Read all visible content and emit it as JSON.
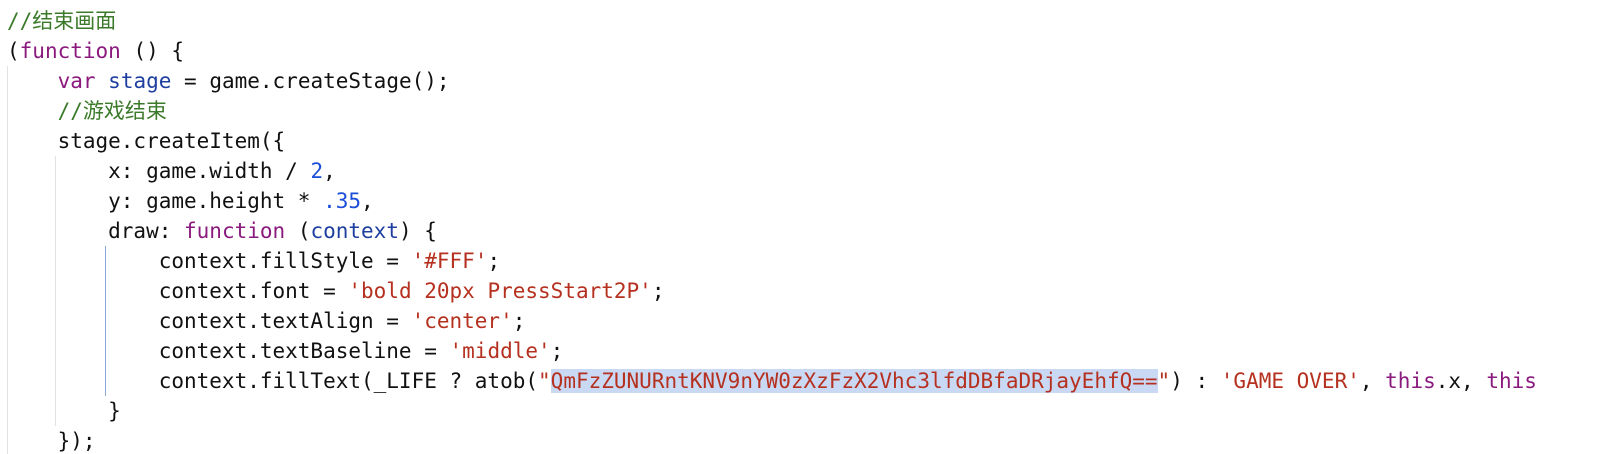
{
  "editor": {
    "language": "javascript",
    "colors": {
      "background": "#ffffff",
      "comment": "#3b7a2a",
      "keyword": "#8a1a7e",
      "variable": "#1e3fa0",
      "number": "#1a4ed8",
      "string": "#b5301f",
      "selection": "#c9d9f3",
      "indent_guide": "#e2e2e2",
      "active_indent_guide": "#8aa7d6"
    },
    "lines": [
      [
        {
          "t": "comment",
          "v": "//结束画面"
        }
      ],
      [
        {
          "t": "plain",
          "v": "("
        },
        {
          "t": "kw",
          "v": "function"
        },
        {
          "t": "plain",
          "v": " () {"
        }
      ],
      [
        {
          "t": "plain",
          "v": "    "
        },
        {
          "t": "kw",
          "v": "var"
        },
        {
          "t": "plain",
          "v": " "
        },
        {
          "t": "var",
          "v": "stage"
        },
        {
          "t": "plain",
          "v": " = game.createStage();"
        }
      ],
      [
        {
          "t": "plain",
          "v": "    "
        },
        {
          "t": "comment",
          "v": "//游戏结束"
        }
      ],
      [
        {
          "t": "plain",
          "v": "    stage.createItem({"
        }
      ],
      [
        {
          "t": "plain",
          "v": "        x: game.width / "
        },
        {
          "t": "num",
          "v": "2"
        },
        {
          "t": "plain",
          "v": ","
        }
      ],
      [
        {
          "t": "plain",
          "v": "        y: game.height * "
        },
        {
          "t": "num",
          "v": ".35"
        },
        {
          "t": "plain",
          "v": ","
        }
      ],
      [
        {
          "t": "plain",
          "v": "        draw: "
        },
        {
          "t": "kw",
          "v": "function"
        },
        {
          "t": "plain",
          "v": " ("
        },
        {
          "t": "var",
          "v": "context"
        },
        {
          "t": "plain",
          "v": ") {"
        }
      ],
      [
        {
          "t": "plain",
          "v": "            context.fillStyle = "
        },
        {
          "t": "str",
          "v": "'#FFF'"
        },
        {
          "t": "plain",
          "v": ";"
        }
      ],
      [
        {
          "t": "plain",
          "v": "            context.font = "
        },
        {
          "t": "str",
          "v": "'bold 20px PressStart2P'"
        },
        {
          "t": "plain",
          "v": ";"
        }
      ],
      [
        {
          "t": "plain",
          "v": "            context.textAlign = "
        },
        {
          "t": "str",
          "v": "'center'"
        },
        {
          "t": "plain",
          "v": ";"
        }
      ],
      [
        {
          "t": "plain",
          "v": "            context.textBaseline = "
        },
        {
          "t": "str",
          "v": "'middle'"
        },
        {
          "t": "plain",
          "v": ";"
        }
      ],
      [
        {
          "t": "plain",
          "v": "            context.fillText(_LIFE ? atob("
        },
        {
          "t": "str",
          "v": "\""
        },
        {
          "t": "sel",
          "v": "QmFzZUNURntKNV9nYW0zXzFzX2Vhc3lfdDBfaDRjayEhfQ=="
        },
        {
          "t": "str",
          "v": "\""
        },
        {
          "t": "plain",
          "v": ") : "
        },
        {
          "t": "str",
          "v": "'GAME OVER'"
        },
        {
          "t": "plain",
          "v": ", "
        },
        {
          "t": "this",
          "v": "this"
        },
        {
          "t": "plain",
          "v": ".x, "
        },
        {
          "t": "this",
          "v": "this"
        }
      ],
      [
        {
          "t": "plain",
          "v": "        }"
        }
      ],
      [
        {
          "t": "plain",
          "v": "    });"
        }
      ]
    ]
  }
}
